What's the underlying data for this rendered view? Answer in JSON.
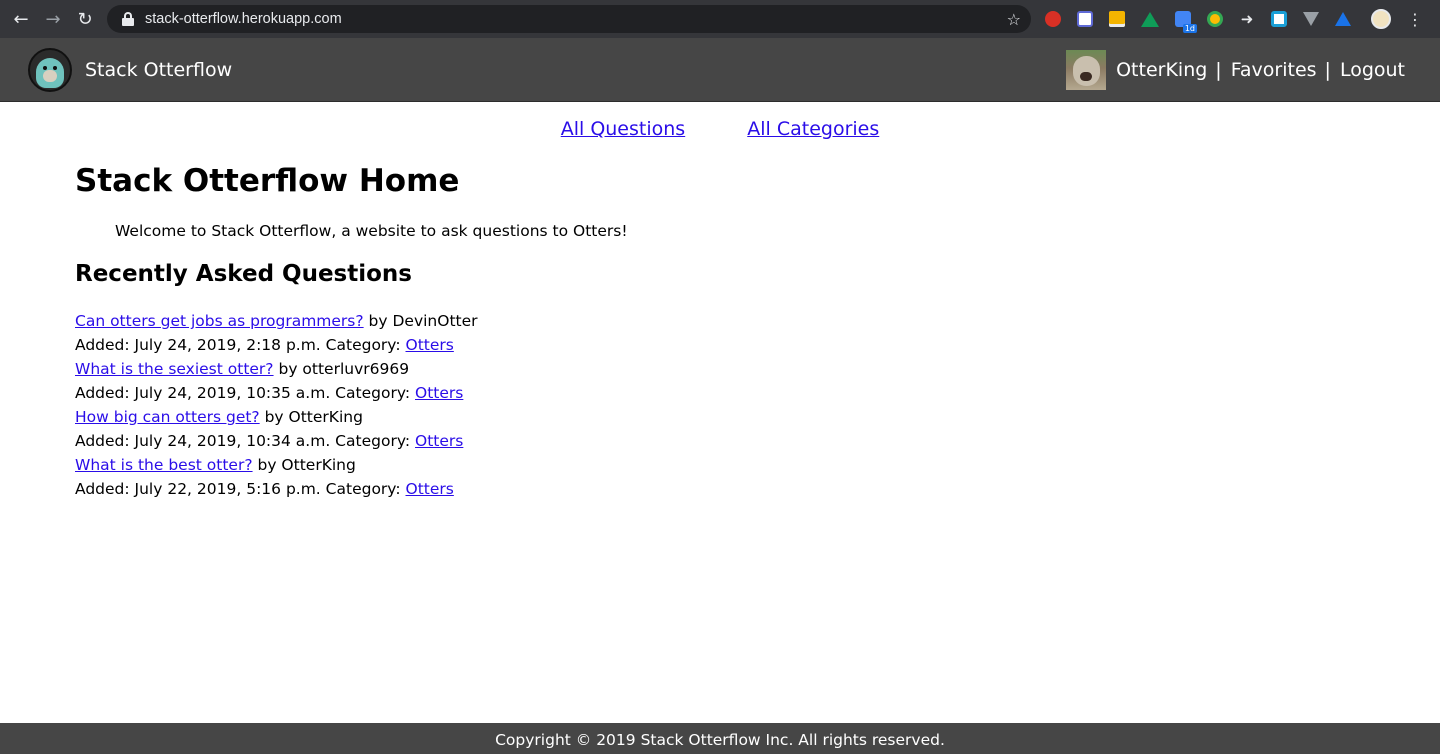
{
  "browser": {
    "url": "stack-otterflow.herokuapp.com",
    "back_icon": "←",
    "forward_icon": "→",
    "reload_icon": "↻",
    "star_icon": "☆",
    "menu_icon": "⋮",
    "extension_badge": "1d",
    "extension_arrow": "➜"
  },
  "navbar": {
    "brand": "Stack Otterflow",
    "username": "OtterKing",
    "separator": "|",
    "favorites": "Favorites",
    "logout": "Logout",
    "background_color": "#464646"
  },
  "subnav": {
    "all_questions": "All Questions",
    "all_categories": "All Categories"
  },
  "main": {
    "title": "Stack Otterflow Home",
    "welcome": "Welcome to Stack Otterflow, a website to ask questions to Otters!",
    "recent_heading": "Recently Asked Questions",
    "questions": [
      {
        "title": "Can otters get jobs as programmers?",
        "by": " by DevinOtter",
        "added": "Added: July 24, 2019, 2:18 p.m. Category: ",
        "category": "Otters"
      },
      {
        "title": "What is the sexiest otter?",
        "by": " by otterluvr6969",
        "added": "Added: July 24, 2019, 10:35 a.m. Category: ",
        "category": "Otters"
      },
      {
        "title": "How big can otters get?",
        "by": " by OtterKing",
        "added": "Added: July 24, 2019, 10:34 a.m. Category: ",
        "category": "Otters"
      },
      {
        "title": "What is the best otter?",
        "by": " by OtterKing",
        "added": "Added: July 22, 2019, 5:16 p.m. Category: ",
        "category": "Otters"
      }
    ],
    "link_color": "#2a0de8"
  },
  "footer": {
    "text": "Copyright © 2019 Stack Otterflow Inc. All rights reserved."
  }
}
